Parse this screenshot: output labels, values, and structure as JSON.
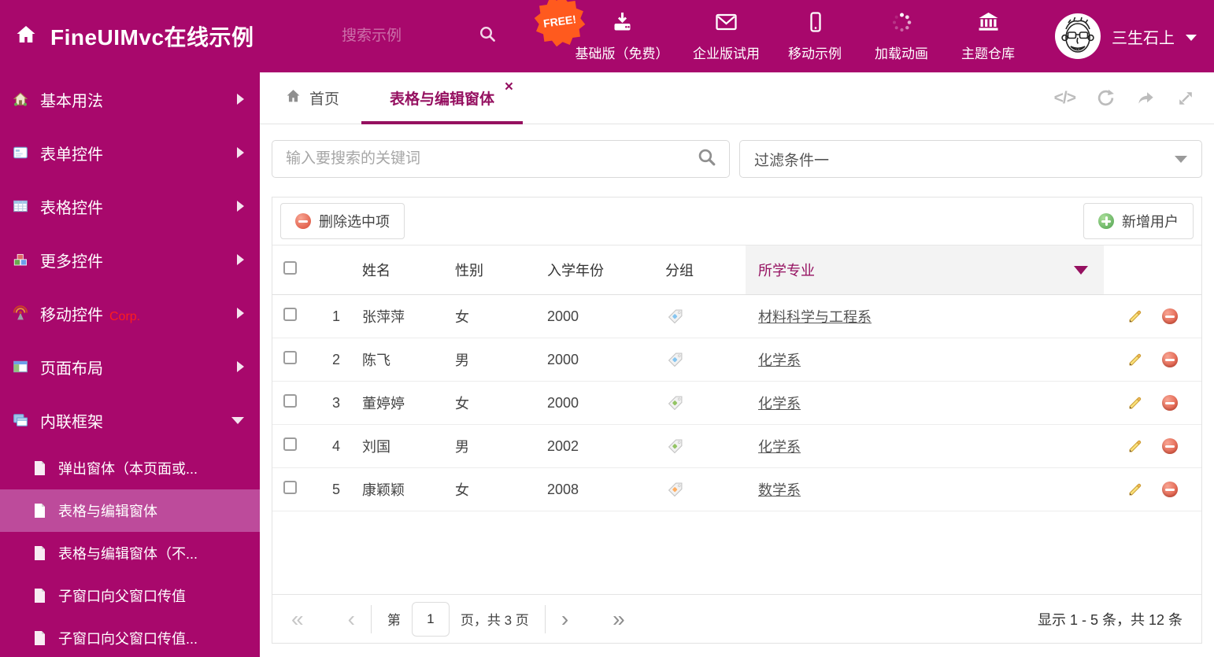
{
  "colors": {
    "accent": "#A8086C",
    "accent_dark": "#951060",
    "sidebar_selected": "#BD4B9B",
    "free_badge": "#FF5A1E",
    "tag_blue": "#85C5F0",
    "tag_green": "#93C464",
    "tag_orange": "#FFAE62",
    "delete_red": "#DA4A35",
    "add_green": "#4FA24F"
  },
  "header": {
    "title": "FineUIMvc在线示例",
    "search_placeholder": "搜索示例",
    "free_badge": "FREE!",
    "nav": [
      {
        "icon": "download-icon",
        "label": "基础版（免费）"
      },
      {
        "icon": "envelope-icon",
        "label": "企业版试用"
      },
      {
        "icon": "mobile-icon",
        "label": "移动示例"
      },
      {
        "icon": "spinner-icon",
        "label": "加载动画"
      },
      {
        "icon": "bank-icon",
        "label": "主题仓库"
      }
    ],
    "user_name": "三生石上"
  },
  "sidebar": {
    "items": [
      {
        "icon": "home-icon",
        "label": "基本用法"
      },
      {
        "icon": "form-icon",
        "label": "表单控件"
      },
      {
        "icon": "table-icon",
        "label": "表格控件"
      },
      {
        "icon": "cubes-icon",
        "label": "更多控件"
      },
      {
        "icon": "antenna-icon",
        "label": "移动控件",
        "badge": "Corp."
      },
      {
        "icon": "layout-icon",
        "label": "页面布局"
      },
      {
        "icon": "frames-icon",
        "label": "内联框架",
        "expanded": true
      }
    ],
    "subitems": [
      {
        "label": "弹出窗体（本页面或...",
        "selected": false
      },
      {
        "label": "表格与编辑窗体",
        "selected": true
      },
      {
        "label": "表格与编辑窗体（不...",
        "selected": false
      },
      {
        "label": "子窗口向父窗口传值",
        "selected": false
      },
      {
        "label": "子窗口向父窗口传值...",
        "selected": false
      }
    ]
  },
  "tabs": {
    "home_label": "首页",
    "active_label": "表格与编辑窗体",
    "close_glyph": "×",
    "code_glyph": "</>"
  },
  "filters": {
    "search_placeholder": "输入要搜索的关键词",
    "dropdown_value": "过滤条件一"
  },
  "toolbar": {
    "delete_label": "删除选中项",
    "add_label": "新增用户"
  },
  "table": {
    "columns": [
      "",
      "",
      "姓名",
      "性别",
      "入学年份",
      "分组",
      "所学专业",
      ""
    ],
    "rows": [
      {
        "num": "1",
        "name": "张萍萍",
        "gender": "女",
        "year": "2000",
        "tag": "blue",
        "major": "材料科学与工程系"
      },
      {
        "num": "2",
        "name": "陈飞",
        "gender": "男",
        "year": "2000",
        "tag": "blue",
        "major": "化学系"
      },
      {
        "num": "3",
        "name": "董婷婷",
        "gender": "女",
        "year": "2000",
        "tag": "green",
        "major": "化学系"
      },
      {
        "num": "4",
        "name": "刘国",
        "gender": "男",
        "year": "2002",
        "tag": "green",
        "major": "化学系"
      },
      {
        "num": "5",
        "name": "康颖颖",
        "gender": "女",
        "year": "2008",
        "tag": "orange",
        "major": "数学系"
      }
    ]
  },
  "pagination": {
    "first": "«",
    "prev": "‹",
    "next": "›",
    "last": "»",
    "page_prefix": "第",
    "page_value": "1",
    "page_suffix": "页，共 3 页",
    "summary": "显示 1 - 5 条，共 12 条"
  }
}
